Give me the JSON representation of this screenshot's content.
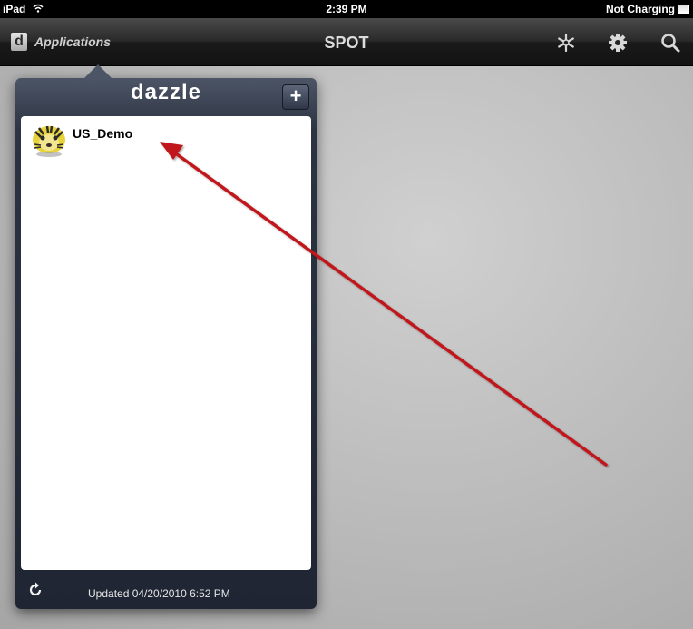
{
  "status_bar": {
    "device": "iPad",
    "time": "2:39 PM",
    "battery_status": "Not Charging"
  },
  "nav_bar": {
    "apps_logo_letter": "d",
    "apps_label": "Applications",
    "title": "SPOT",
    "icons": [
      "snowflake-icon",
      "gear-icon",
      "search-icon"
    ]
  },
  "popover": {
    "title": "dazzle",
    "add_label": "+",
    "apps": [
      {
        "name": "US_Demo",
        "icon": "tiger-icon"
      }
    ],
    "footer": {
      "updated_text": "Updated 04/20/2010 6:52 PM",
      "refresh_icon": "refresh-icon"
    }
  },
  "annotation": {
    "arrow_color": "#c0161a"
  }
}
